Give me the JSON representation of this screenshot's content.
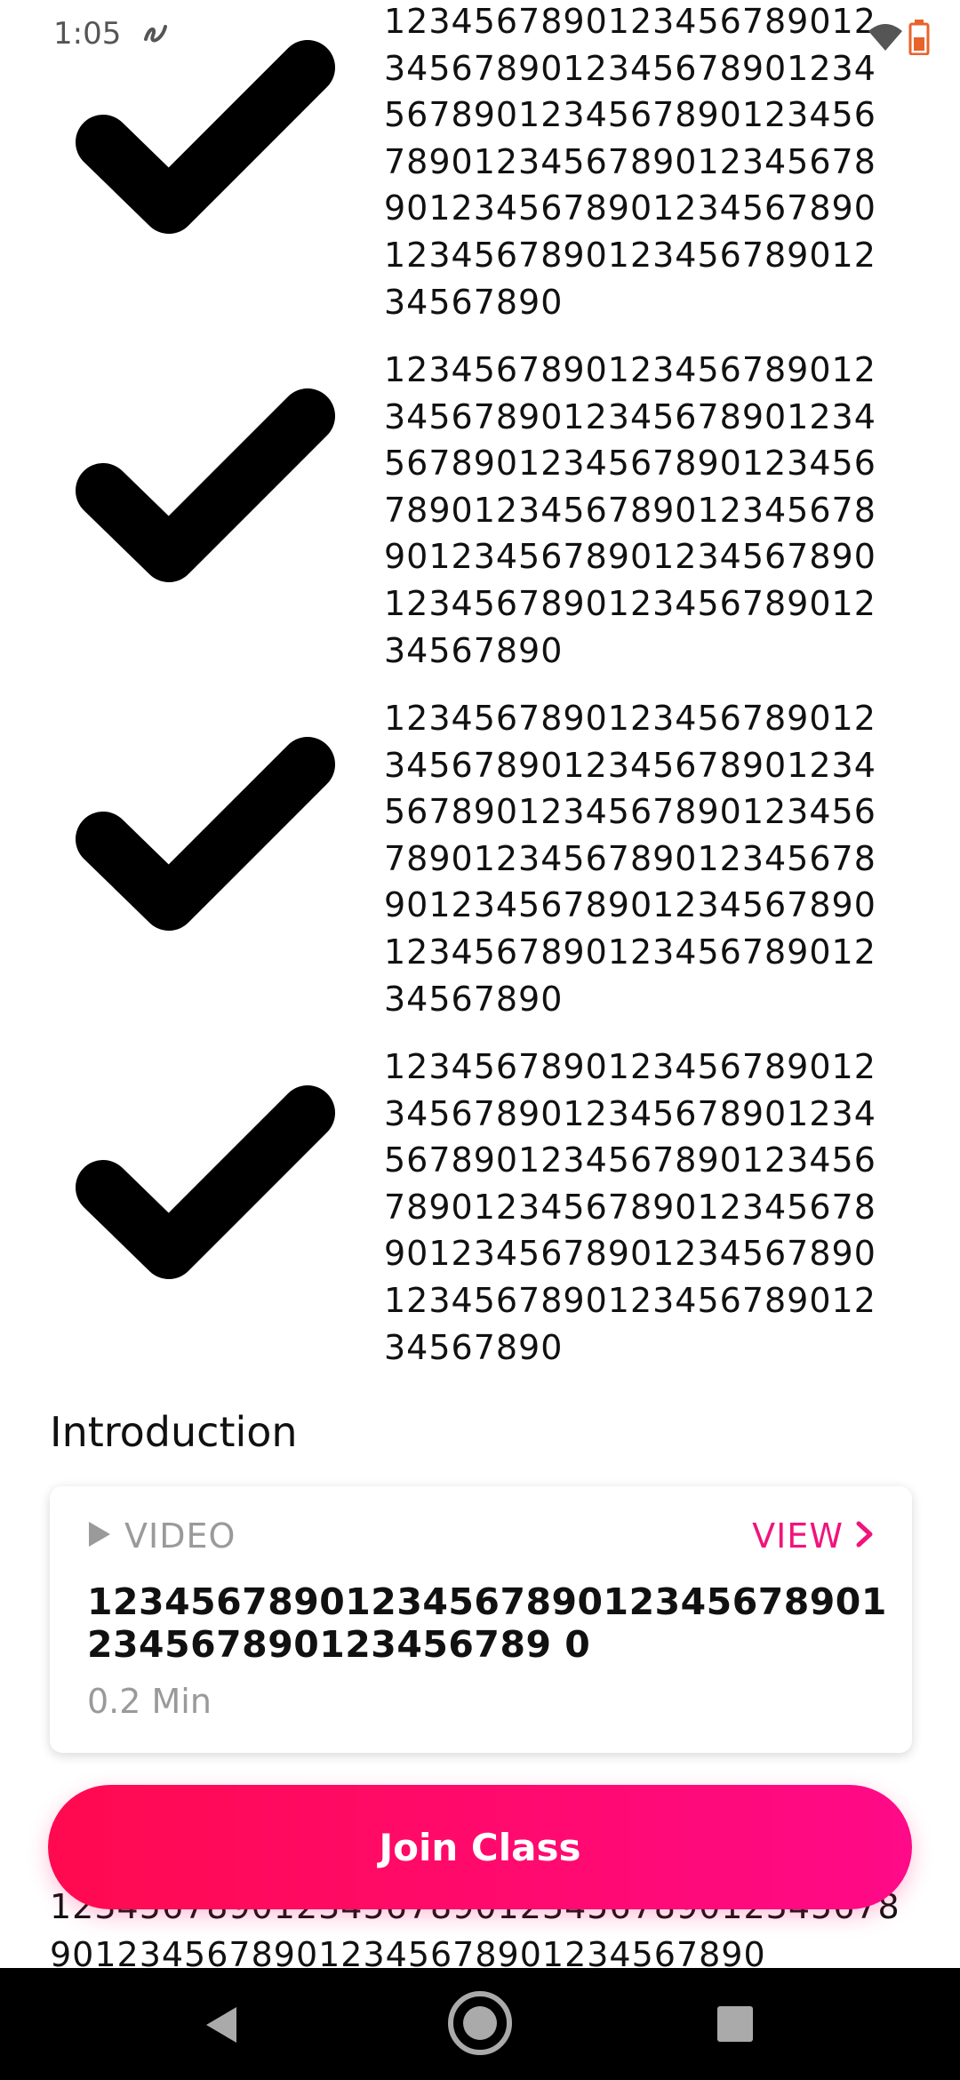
{
  "status_bar": {
    "time": "1:05",
    "icons": [
      "app-notification-icon",
      "wifi-icon",
      "battery-icon"
    ]
  },
  "checklist": {
    "items": [
      {
        "text": "12345678901234567890123​45678901234567890123456​78901234567890123456789​01234567890123456789012​34567890123456789012345​67890123456789012345678​90",
        "icon": "checkmark-icon"
      },
      {
        "text": "12345678901234567890123​45678901234567890123456​78901234567890123456789​01234567890123456789012​34567890123456789012345​67890123456789012345678​90",
        "icon": "checkmark-icon"
      },
      {
        "text": "12345678901234567890123​45678901234567890123456​78901234567890123456789​01234567890123456789012​34567890123456789012345​67890123456789012345678​90",
        "icon": "checkmark-icon"
      },
      {
        "text": "12345678901234567890123​45678901234567890123456​78901234567890123456789​01234567890123456789012​34567890123456789012345​67890123456789012345678​90",
        "icon": "checkmark-icon"
      }
    ]
  },
  "introduction": {
    "title": "Introduction",
    "video": {
      "type_label": "VIDEO",
      "view_label": "VIEW",
      "title": "1234567890123456789012345678901234567890123456789 0",
      "duration": "0.2 Min"
    }
  },
  "join_button": {
    "label": "Join Class"
  },
  "bottom_text": "1234567890123456789012345678901234567890123456789012345678901234567890"
}
